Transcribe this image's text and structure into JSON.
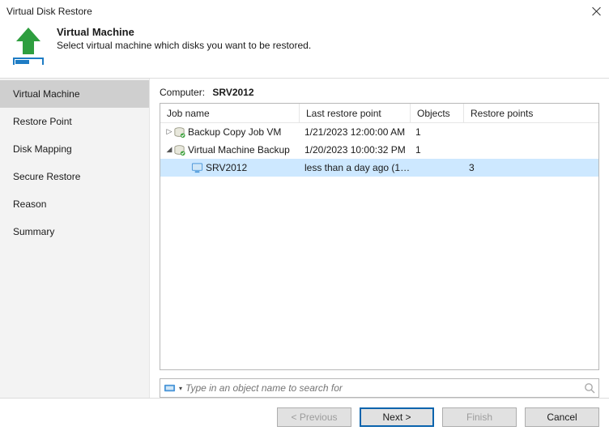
{
  "window": {
    "title": "Virtual Disk Restore"
  },
  "header": {
    "title": "Virtual Machine",
    "subtitle": "Select virtual machine which disks you want to be restored."
  },
  "sidebar": {
    "items": [
      {
        "label": "Virtual Machine",
        "selected": true
      },
      {
        "label": "Restore Point"
      },
      {
        "label": "Disk Mapping"
      },
      {
        "label": "Secure Restore"
      },
      {
        "label": "Reason"
      },
      {
        "label": "Summary"
      }
    ]
  },
  "main": {
    "computer_label": "Computer:",
    "computer_value": "SRV2012",
    "columns": {
      "name": "Job name",
      "last": "Last restore point",
      "objects": "Objects",
      "restore_points": "Restore points"
    },
    "rows": [
      {
        "depth": 0,
        "expander": "closed",
        "icon": "job",
        "name": "Backup Copy Job VM",
        "last": "1/21/2023 12:00:00 AM",
        "objects": "1",
        "restore_points": "",
        "selected": false
      },
      {
        "depth": 0,
        "expander": "open",
        "icon": "job",
        "name": "Virtual Machine Backup",
        "last": "1/20/2023 10:00:32 PM",
        "objects": "1",
        "restore_points": "",
        "selected": false
      },
      {
        "depth": 1,
        "expander": "none",
        "icon": "vm",
        "name": "SRV2012",
        "last": "less than a day ago (1…",
        "objects": "",
        "restore_points": "3",
        "selected": true
      }
    ]
  },
  "search": {
    "placeholder": "Type in an object name to search for"
  },
  "buttons": {
    "previous": "< Previous",
    "next": "Next >",
    "finish": "Finish",
    "cancel": "Cancel"
  }
}
